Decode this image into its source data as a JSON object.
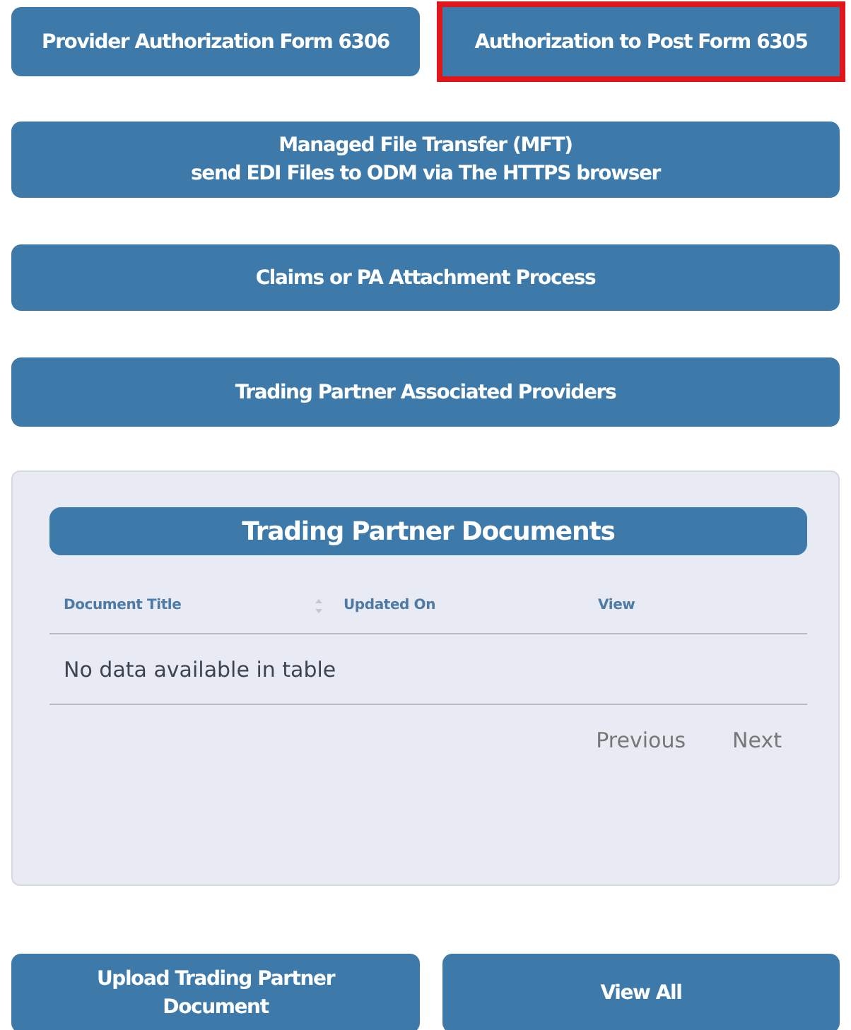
{
  "top_buttons": [
    {
      "label": "Provider Authorization Form 6306",
      "highlighted": false
    },
    {
      "label": "Authorization to Post Form 6305",
      "highlighted": true
    }
  ],
  "wide_buttons": [
    {
      "lines": [
        "Managed File Transfer (MFT)",
        "send EDI Files to ODM via The HTTPS browser"
      ]
    },
    {
      "lines": [
        "Claims or PA Attachment Process"
      ]
    },
    {
      "lines": [
        "Trading Partner Associated Providers"
      ]
    }
  ],
  "documents_panel": {
    "title": "Trading Partner Documents",
    "columns": [
      {
        "label": "Document Title"
      },
      {
        "label": "Updated On"
      },
      {
        "label": "View"
      }
    ],
    "empty_message": "No data available in table",
    "pagination": [
      "Previous",
      "Next"
    ]
  },
  "bottom_buttons": [
    {
      "lines": [
        "Upload Trading Partner",
        "Document"
      ]
    },
    {
      "lines": [
        "View All"
      ]
    }
  ]
}
